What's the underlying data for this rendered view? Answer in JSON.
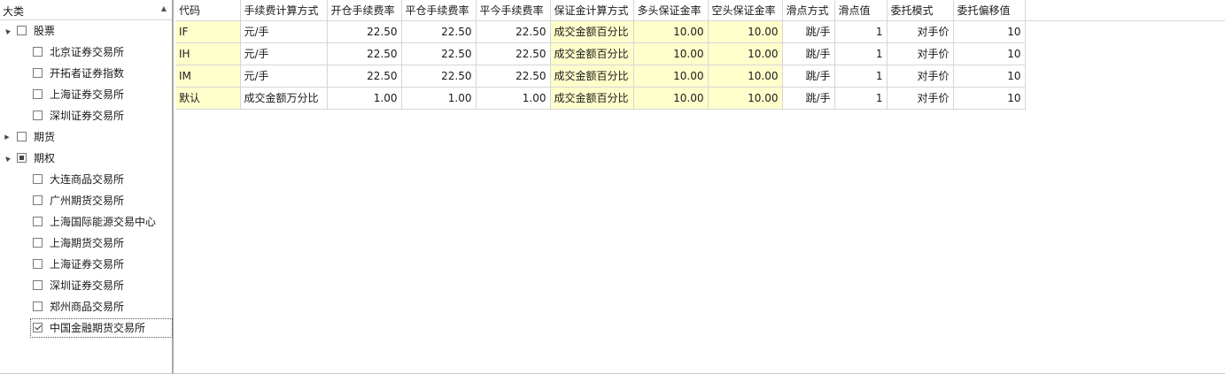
{
  "tree": {
    "header": "大类",
    "nodes": [
      {
        "label": "股票",
        "level": 0,
        "expander": "▲",
        "state": "unchecked"
      },
      {
        "label": "北京证券交易所",
        "level": 1,
        "state": "unchecked"
      },
      {
        "label": "开拓者证券指数",
        "level": 1,
        "state": "unchecked"
      },
      {
        "label": "上海证券交易所",
        "level": 1,
        "state": "unchecked"
      },
      {
        "label": "深圳证券交易所",
        "level": 1,
        "state": "unchecked"
      },
      {
        "label": "期货",
        "level": 0,
        "expander": "▶",
        "state": "unchecked"
      },
      {
        "label": "期权",
        "level": 0,
        "expander": "▲",
        "state": "partial"
      },
      {
        "label": "大连商品交易所",
        "level": 1,
        "state": "unchecked"
      },
      {
        "label": "广州期货交易所",
        "level": 1,
        "state": "unchecked"
      },
      {
        "label": "上海国际能源交易中心",
        "level": 1,
        "state": "unchecked"
      },
      {
        "label": "上海期货交易所",
        "level": 1,
        "state": "unchecked"
      },
      {
        "label": "上海证券交易所",
        "level": 1,
        "state": "unchecked"
      },
      {
        "label": "深圳证券交易所",
        "level": 1,
        "state": "unchecked"
      },
      {
        "label": "郑州商品交易所",
        "level": 1,
        "state": "unchecked"
      },
      {
        "label": "中国金融期货交易所",
        "level": 1,
        "state": "checked",
        "selected": true
      }
    ]
  },
  "grid": {
    "columns": [
      "代码",
      "手续费计算方式",
      "开仓手续费率",
      "平仓手续费率",
      "平今手续费率",
      "保证金计算方式",
      "多头保证金率",
      "空头保证金率",
      "滑点方式",
      "滑点值",
      "委托模式",
      "委托偏移值"
    ],
    "rows": [
      [
        "IF",
        "元/手",
        "22.50",
        "22.50",
        "22.50",
        "成交金额百分比",
        "10.00",
        "10.00",
        "跳/手",
        "1",
        "对手价",
        "10"
      ],
      [
        "IH",
        "元/手",
        "22.50",
        "22.50",
        "22.50",
        "成交金额百分比",
        "10.00",
        "10.00",
        "跳/手",
        "1",
        "对手价",
        "10"
      ],
      [
        "IM",
        "元/手",
        "22.50",
        "22.50",
        "22.50",
        "成交金额百分比",
        "10.00",
        "10.00",
        "跳/手",
        "1",
        "对手价",
        "10"
      ],
      [
        "默认",
        "成交金额万分比",
        "1.00",
        "1.00",
        "1.00",
        "成交金额百分比",
        "10.00",
        "10.00",
        "跳/手",
        "1",
        "对手价",
        "10"
      ]
    ],
    "highlight_color": "#ffffcc"
  }
}
